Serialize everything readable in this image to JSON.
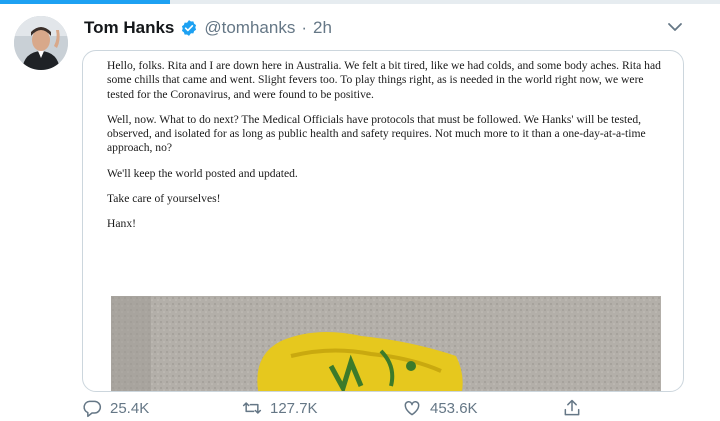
{
  "author": {
    "name": "Tom Hanks",
    "handle": "@tomhanks",
    "separator": "·",
    "time": "2h"
  },
  "icons": {
    "verified": "verified-badge-icon",
    "menu": "chevron-down-icon",
    "reply": "reply-icon",
    "retweet": "retweet-icon",
    "like": "heart-icon",
    "share": "share-icon"
  },
  "colors": {
    "accent": "#1da1f2",
    "muted": "#657786",
    "border": "#ccd6dd"
  },
  "note": {
    "paragraphs": [
      "Hello, folks. Rita and I are down here in Australia. We felt a bit tired, like we had colds, and some body aches. Rita had some chills that came and went. Slight fevers too. To play things right, as is needed in the world right now, we were tested for the Coronavirus, and were found to be positive.",
      "Well, now. What to do next? The Medical Officials have protocols that must be followed. We Hanks' will be tested, observed, and isolated for as long as public health and safety requires.  Not much more to it than a one-day-at-a-time approach, no?",
      "We'll keep the world posted and updated.",
      "Take care of yourselves!",
      "Hanx!"
    ]
  },
  "stats": {
    "replies": "25.4K",
    "retweets": "127.7K",
    "likes": "453.6K"
  }
}
